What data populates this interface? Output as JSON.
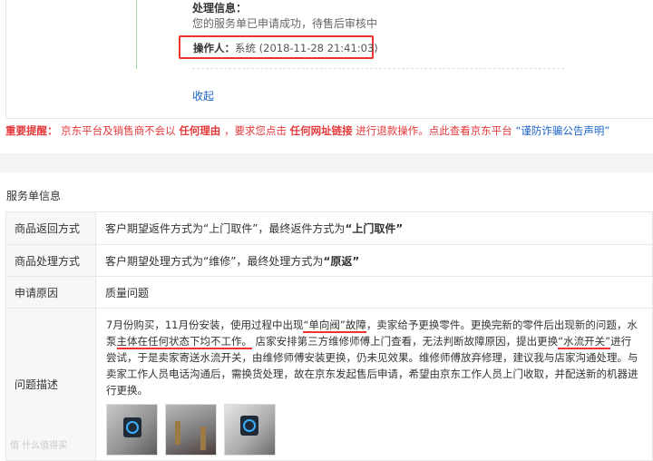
{
  "process": {
    "title": "处理信息：",
    "status": "您的服务单已申请成功，待售后审核中",
    "operator_label": "操作人：",
    "operator_value": "系统 (2018-11-28 21:41:03)",
    "collapse": "收起"
  },
  "warning": {
    "label": "重要提醒：",
    "t1": "京东平台及销售商不会以",
    "e1": "任何理由",
    "t2": "，要求您点击",
    "e2": "任何网址链接",
    "t3": "进行退款操作。点此查看京东平台",
    "link": "“谨防诈骗公告声明”"
  },
  "section_title": "服务单信息",
  "rows": {
    "return_method": {
      "label": "商品返回方式",
      "text": "客户期望返件方式为“上门取件”，最终返件方式为",
      "bold": "“上门取件”"
    },
    "process_method": {
      "label": "商品处理方式",
      "text": "客户期望处理方式为“维修”，最终处理方式为",
      "bold": "“原返”"
    },
    "reason": {
      "label": "申请原因",
      "value": "质量问题"
    },
    "description": {
      "label": "问题描述",
      "p1": "7月份购买，11月份安装，使用过程中出现",
      "u1": "“单向阀”故障",
      "p2": "，卖家给予更换零件。更换完新的零件后出现新的问题，水泵",
      "u2": "主体在任何状态下均不工作。",
      "p3": "店家安排第三方维修师傅上门查看，无法判断故障原因，提出更换",
      "u3": "“水流开关”",
      "p4": "进行尝试，于是卖家寄送水流开关，由维修师傅安装更换，仍未见效果。维修师傅放弃修理，建议我与店家沟通处理。与卖家工作人员电话沟通后，需换货处理，故在京东发起售后申请，希望由京东工作人员上门收取，并配送新的机器进行更换。"
    }
  },
  "watermark": "值 什么值得买",
  "colors": {
    "warning_red": "#e4393c",
    "link_blue": "#1a63c6",
    "highlight_box": "#e33"
  }
}
